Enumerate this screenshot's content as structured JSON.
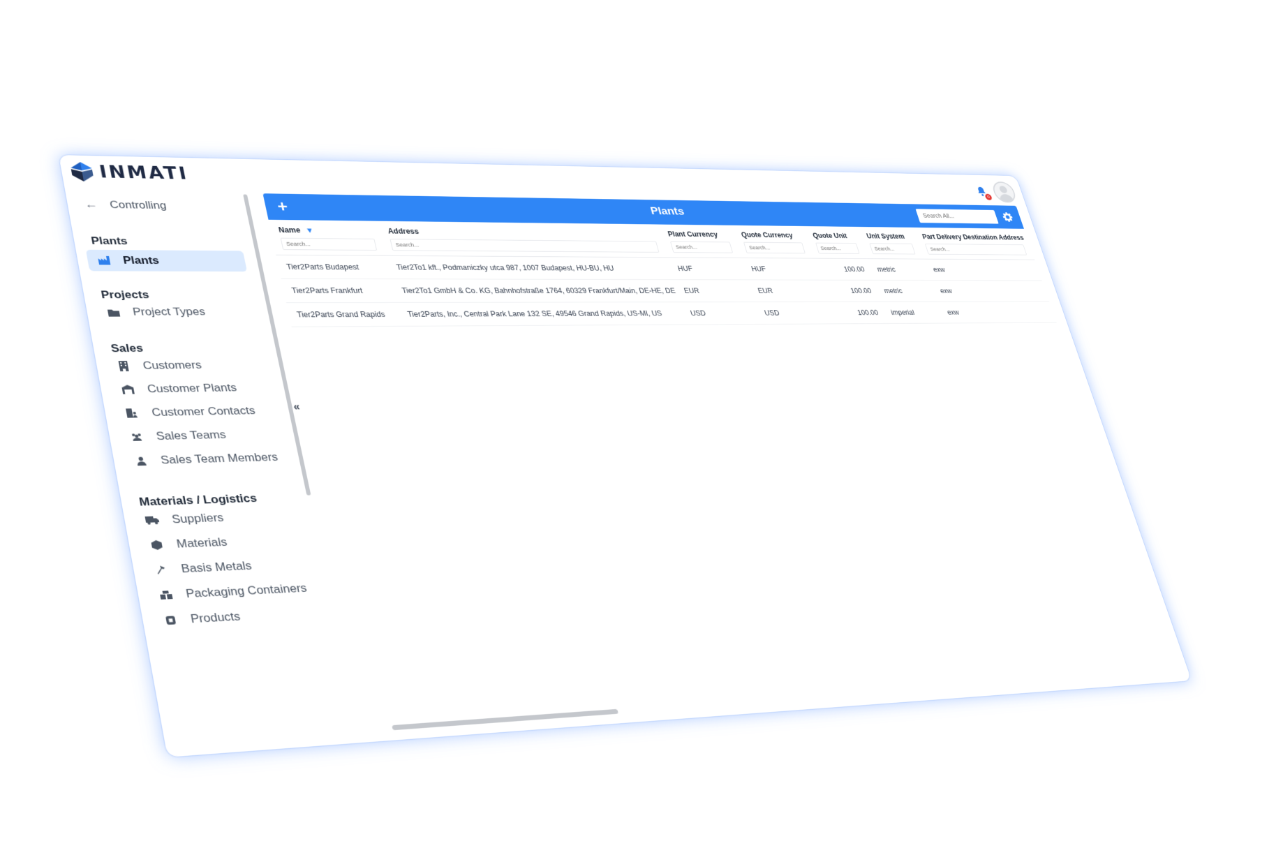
{
  "brand": {
    "name": "INMATI"
  },
  "header": {
    "notification_icon": "notification-bell-icon",
    "notification_count": "0",
    "avatar": "user-avatar-icon"
  },
  "sidebar": {
    "back_label": "Controlling",
    "collapse_label": "«",
    "groups": {
      "plants": {
        "title": "Plants",
        "items": [
          {
            "label": "Plants",
            "icon": "factory-icon",
            "active": true
          }
        ]
      },
      "projects": {
        "title": "Projects",
        "items": [
          {
            "label": "Project Types",
            "icon": "folder-icon"
          }
        ]
      },
      "sales": {
        "title": "Sales",
        "items": [
          {
            "label": "Customers",
            "icon": "building-icon"
          },
          {
            "label": "Customer Plants",
            "icon": "warehouse-icon"
          },
          {
            "label": "Customer Contacts",
            "icon": "contacts-icon"
          },
          {
            "label": "Sales Teams",
            "icon": "team-icon"
          },
          {
            "label": "Sales Team Members",
            "icon": "person-icon"
          }
        ]
      },
      "materials": {
        "title": "Materials / Logistics",
        "items": [
          {
            "label": "Suppliers",
            "icon": "truck-icon"
          },
          {
            "label": "Materials",
            "icon": "cube-icon"
          },
          {
            "label": "Basis Metals",
            "icon": "hammer-icon"
          },
          {
            "label": "Packaging Containers",
            "icon": "boxes-icon"
          },
          {
            "label": "Products",
            "icon": "chip-icon"
          }
        ]
      }
    }
  },
  "main": {
    "title": "Plants",
    "add_label": "+",
    "search_all_placeholder": "Search All...",
    "filter_placeholder": "Search...",
    "columns": [
      "Name",
      "Address",
      "Plant Currency",
      "Quote Currency",
      "Quote Unit",
      "Unit System",
      "Part Delivery Destination Address"
    ],
    "rows": [
      [
        "Tier2Parts Budapest",
        "Tier2To1 kft., Podmaniczky utca 987, 1007 Budapest, HU-BU, HU",
        "HUF",
        "HUF",
        "100.00",
        "metric",
        "exw"
      ],
      [
        "Tier2Parts Frankfurt",
        "Tier2To1 GmbH & Co. KG, Bahnhofstraße 1764, 60329 Frankfurt/Main, DE-HE, DE",
        "EUR",
        "EUR",
        "100.00",
        "metric",
        "exw"
      ],
      [
        "Tier2Parts Grand Rapids",
        "Tier2Parts, Inc., Central Park Lane 132 SE, 49546 Grand Rapids, US-MI, US",
        "USD",
        "USD",
        "100.00",
        "imperial",
        "exw"
      ]
    ]
  },
  "colors": {
    "accent": "#2f86f6",
    "active_bg": "#dbeafe",
    "glow": "#6ea0ff"
  }
}
